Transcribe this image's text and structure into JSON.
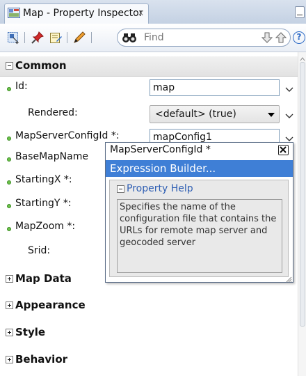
{
  "tab": {
    "title": "Map - Property Inspector",
    "close_glyph": "x"
  },
  "toolbar": {
    "icons": [
      "select-component-icon",
      "pin-icon",
      "edit-source-icon",
      "pencil-icon"
    ],
    "find_placeholder": "Find",
    "help_glyph": "?"
  },
  "sections": {
    "common": "Common",
    "map_data": "Map Data",
    "appearance": "Appearance",
    "style": "Style",
    "behavior": "Behavior"
  },
  "properties": [
    {
      "label": "Id:",
      "required": true,
      "value": "map"
    },
    {
      "label": "Rendered:",
      "required": false,
      "value": "<default> (true)"
    },
    {
      "label": "MapServerConfigId *:",
      "required": true,
      "value": "mapConfig1"
    },
    {
      "label": "BaseMapName",
      "required": true,
      "value": ""
    },
    {
      "label": "StartingX *:",
      "required": true,
      "value": ""
    },
    {
      "label": "StartingY *:",
      "required": true,
      "value": ""
    },
    {
      "label": "MapZoom *:",
      "required": true,
      "value": ""
    },
    {
      "label": "Srid:",
      "required": false,
      "value": ""
    }
  ],
  "popup": {
    "title": "MapServerConfigId *",
    "expression_builder": "Expression Builder...",
    "help_header": "Property Help",
    "help_text": "Specifies the name of the configuration file that contains the URLs for remote map server and geocoded server"
  },
  "colors": {
    "selection": "#3f7fd6",
    "required_dot": "#6cc24a",
    "help_header": "#2f5fb3"
  }
}
